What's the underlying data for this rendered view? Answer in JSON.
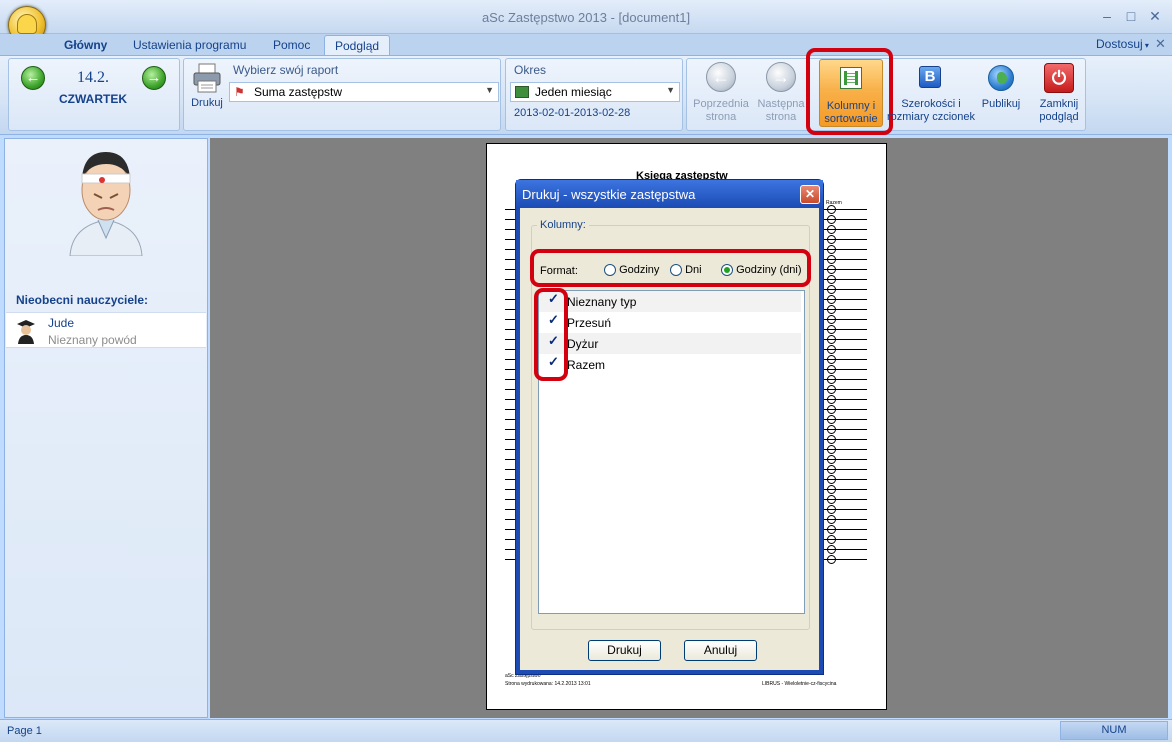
{
  "window": {
    "title": "aSc Zastępstwo 2013  - [document1]",
    "min": "–",
    "max": "□",
    "close": "✕",
    "mdi_close": "✕"
  },
  "tabs": [
    "Główny",
    "Ustawienia programu",
    "Pomoc",
    "Podgląd"
  ],
  "active_tab": "Podgląd",
  "customize": "Dostosuj",
  "ribbon": {
    "date": "14.2.",
    "day": "CZWARTEK",
    "print_label": "Drukuj",
    "report_label": "Wybierz swój raport",
    "report_value": "Suma zastępstw",
    "period_label": "Okres",
    "period_value": "Jeden miesiąc",
    "period_range": "2013-02-01-2013-02-28",
    "prev_page": [
      "Poprzednia",
      "strona"
    ],
    "next_page": [
      "Następna",
      "strona"
    ],
    "columns_sort": [
      "Kolumny i",
      "sortowanie"
    ],
    "widths_fonts": [
      "Szerokości i",
      "rozmiary czcionek"
    ],
    "publish": "Publikuj",
    "close_preview": [
      "Zamknij",
      "podgląd"
    ]
  },
  "left_panel": {
    "absent_title": "Nieobecni nauczyciele:",
    "teacher_name": "Jude",
    "teacher_reason": "Nieznany powód"
  },
  "paper": {
    "title": "Księga zastępstw",
    "col_header": "Razem",
    "footer_left1": "aSc Zastępstwo",
    "footer_left2": "Strona wydrukowana: 14.2.2013 13:01",
    "footer_right": "LIBRUS - Wieloletnie-cz-fiscycina"
  },
  "dialog": {
    "title": "Drukuj - wszystkie zastępstwa",
    "close": "✕",
    "group_label": "Kolumny:",
    "format_label": "Format:",
    "format_options": [
      {
        "label": "Godziny",
        "selected": false
      },
      {
        "label": "Dni",
        "selected": false
      },
      {
        "label": "Godziny (dni)",
        "selected": true
      }
    ],
    "columns": [
      {
        "label": "Nieznany typ",
        "checked": true
      },
      {
        "label": "Przesuń",
        "checked": true
      },
      {
        "label": "Dyżur",
        "checked": true
      },
      {
        "label": "Razem",
        "checked": true
      }
    ],
    "print_button": "Drukuj",
    "cancel_button": "Anuluj"
  },
  "status": {
    "page": "Page 1",
    "num": "NUM"
  },
  "colors": {
    "highlight": "#d30010",
    "ribbon_text": "#15428b",
    "dialog_title": "#1c4bb4",
    "active_button": "#f8b14a"
  }
}
